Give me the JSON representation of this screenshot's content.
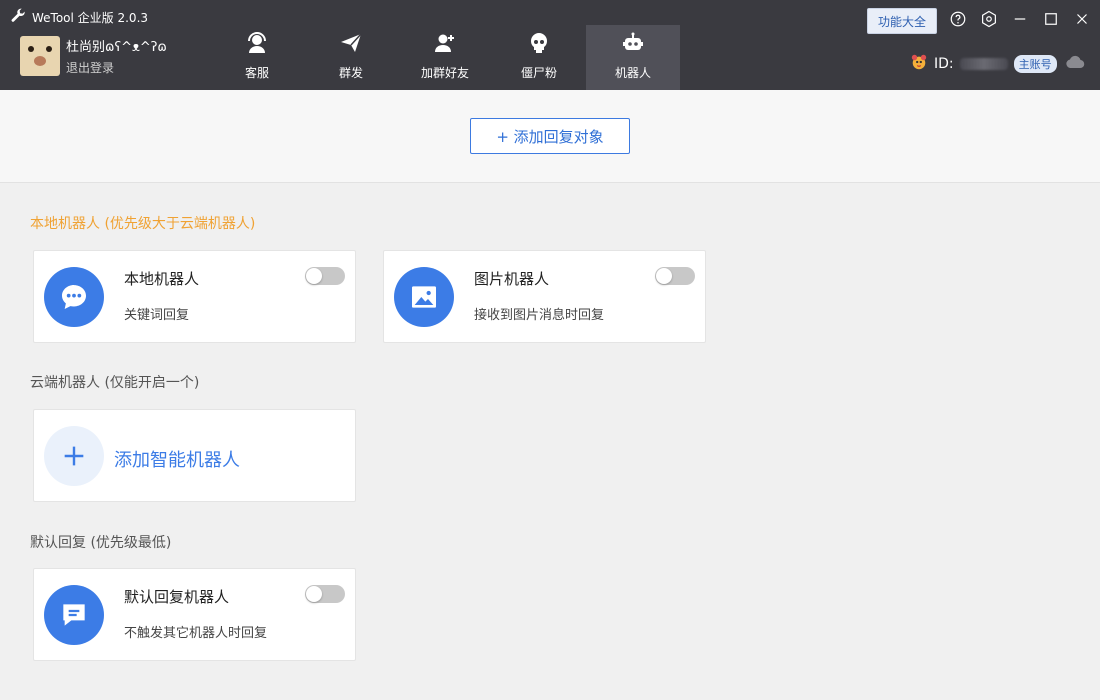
{
  "window": {
    "title": "WeTool 企业版 2.0.3",
    "function_button": "功能大全"
  },
  "user": {
    "name": "杜尚别ɷʕ^ᴥ^ʔɷ",
    "logout": "退出登录",
    "id_label": "ID:",
    "account_badge": "主账号"
  },
  "tabs": [
    {
      "label": "客服",
      "icon": "customer-service-icon"
    },
    {
      "label": "群发",
      "icon": "send-icon"
    },
    {
      "label": "加群好友",
      "icon": "add-friend-icon"
    },
    {
      "label": "僵尸粉",
      "icon": "skull-icon"
    },
    {
      "label": "机器人",
      "icon": "robot-icon",
      "active": true
    }
  ],
  "main": {
    "add_target_button": "+ 添加回复对象",
    "sections": {
      "local": {
        "title": "本地机器人 (优先级大于云端机器人)",
        "cards": [
          {
            "title": "本地机器人",
            "desc": "关键词回复",
            "enabled": false
          },
          {
            "title": "图片机器人",
            "desc": "接收到图片消息时回复",
            "enabled": false
          }
        ]
      },
      "cloud": {
        "title": "云端机器人 (仅能开启一个)",
        "add_label": "添加智能机器人"
      },
      "default": {
        "title": "默认回复 (优先级最低)",
        "cards": [
          {
            "title": "默认回复机器人",
            "desc": "不触发其它机器人时回复",
            "enabled": false
          }
        ]
      }
    }
  },
  "colors": {
    "header_bg": "#3a3a40",
    "accent": "#3c7ce6",
    "warning_title": "#f0a233"
  }
}
